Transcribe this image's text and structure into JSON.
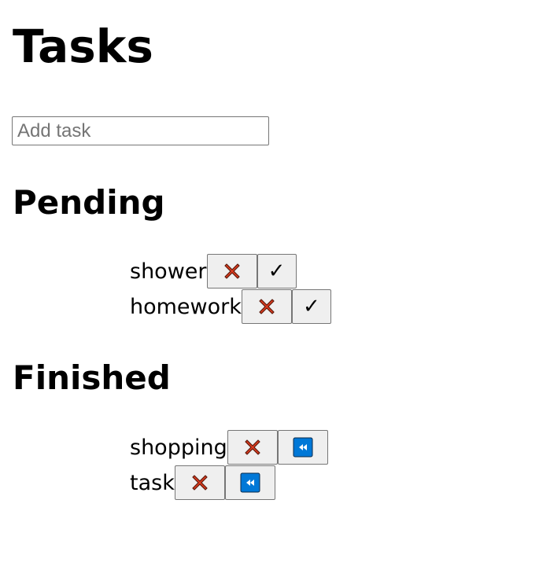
{
  "header": {
    "title": "Tasks"
  },
  "add_task": {
    "placeholder": "Add task",
    "value": ""
  },
  "pending": {
    "heading": "Pending",
    "items": [
      {
        "label": "shower",
        "delete_icon": "cross-mark-icon",
        "action_icon": "check-icon",
        "action_glyph": "✓"
      },
      {
        "label": "homework",
        "delete_icon": "cross-mark-icon",
        "action_icon": "check-icon",
        "action_glyph": "✓"
      }
    ]
  },
  "finished": {
    "heading": "Finished",
    "items": [
      {
        "label": "shopping",
        "delete_icon": "cross-mark-icon",
        "action_icon": "rewind-icon"
      },
      {
        "label": "task",
        "delete_icon": "cross-mark-icon",
        "action_icon": "rewind-icon"
      }
    ]
  },
  "colors": {
    "cross_mark": "#dd3b1f",
    "rewind_bg": "#0078d7",
    "button_bg": "#efefef",
    "button_border": "#767676"
  }
}
